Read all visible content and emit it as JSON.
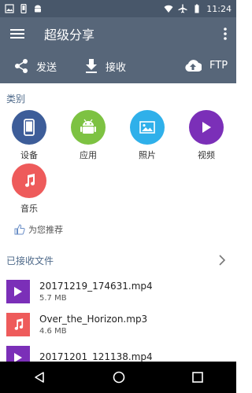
{
  "status_bar": {
    "time": "11:24"
  },
  "app_bar": {
    "title": "超级分享"
  },
  "actions": {
    "send": "发送",
    "receive": "接收",
    "ftp": "FTP"
  },
  "categories": {
    "label": "类别",
    "items": [
      {
        "label": "设备",
        "color": "#3d5d99"
      },
      {
        "label": "应用",
        "color": "#7dc242"
      },
      {
        "label": "照片",
        "color": "#2fb0ea"
      },
      {
        "label": "视频",
        "color": "#7b2fb8"
      },
      {
        "label": "音乐",
        "color": "#ee5b5b"
      }
    ]
  },
  "recommend": {
    "label": "为您推荐"
  },
  "received": {
    "label": "已接收文件",
    "files": [
      {
        "name": "20171219_174631.mp4",
        "size": "5.7 MB",
        "icon": "video-file-icon"
      },
      {
        "name": "Over_the_Horizon.mp3",
        "size": "4.6 MB",
        "icon": "music-file-icon"
      },
      {
        "name": "20171201_121138.mp4",
        "size": "",
        "icon": "video-file-icon"
      }
    ]
  }
}
